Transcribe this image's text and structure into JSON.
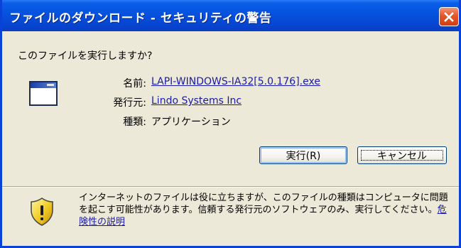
{
  "window": {
    "title": "ファイルのダウンロード - セキュリティの警告",
    "close_icon": "close-icon"
  },
  "dialog": {
    "question": "このファイルを実行しますか?",
    "name_label": "名前:",
    "name_value": "LAPI-WINDOWS-IA32[5.0.176].exe",
    "publisher_label": "発行元:",
    "publisher_value": "Lindo Systems Inc",
    "type_label": "種類:",
    "type_value": "アプリケーション"
  },
  "buttons": {
    "run_label": "実行(R)",
    "cancel_label": "キャンセル"
  },
  "warning": {
    "text": "インターネットのファイルは役に立ちますが、このファイルの種類はコンピュータに問題を起こす可能性があります。信頼する発行元のソフトウェアのみ、実行してください。",
    "link": "危険性の説明",
    "icon": "security-shield-icon"
  },
  "colors": {
    "titlebar": "#0551dd",
    "dialog_bg": "#ece9d8",
    "link": "#1a1aa8",
    "close_button": "#e2572b"
  }
}
